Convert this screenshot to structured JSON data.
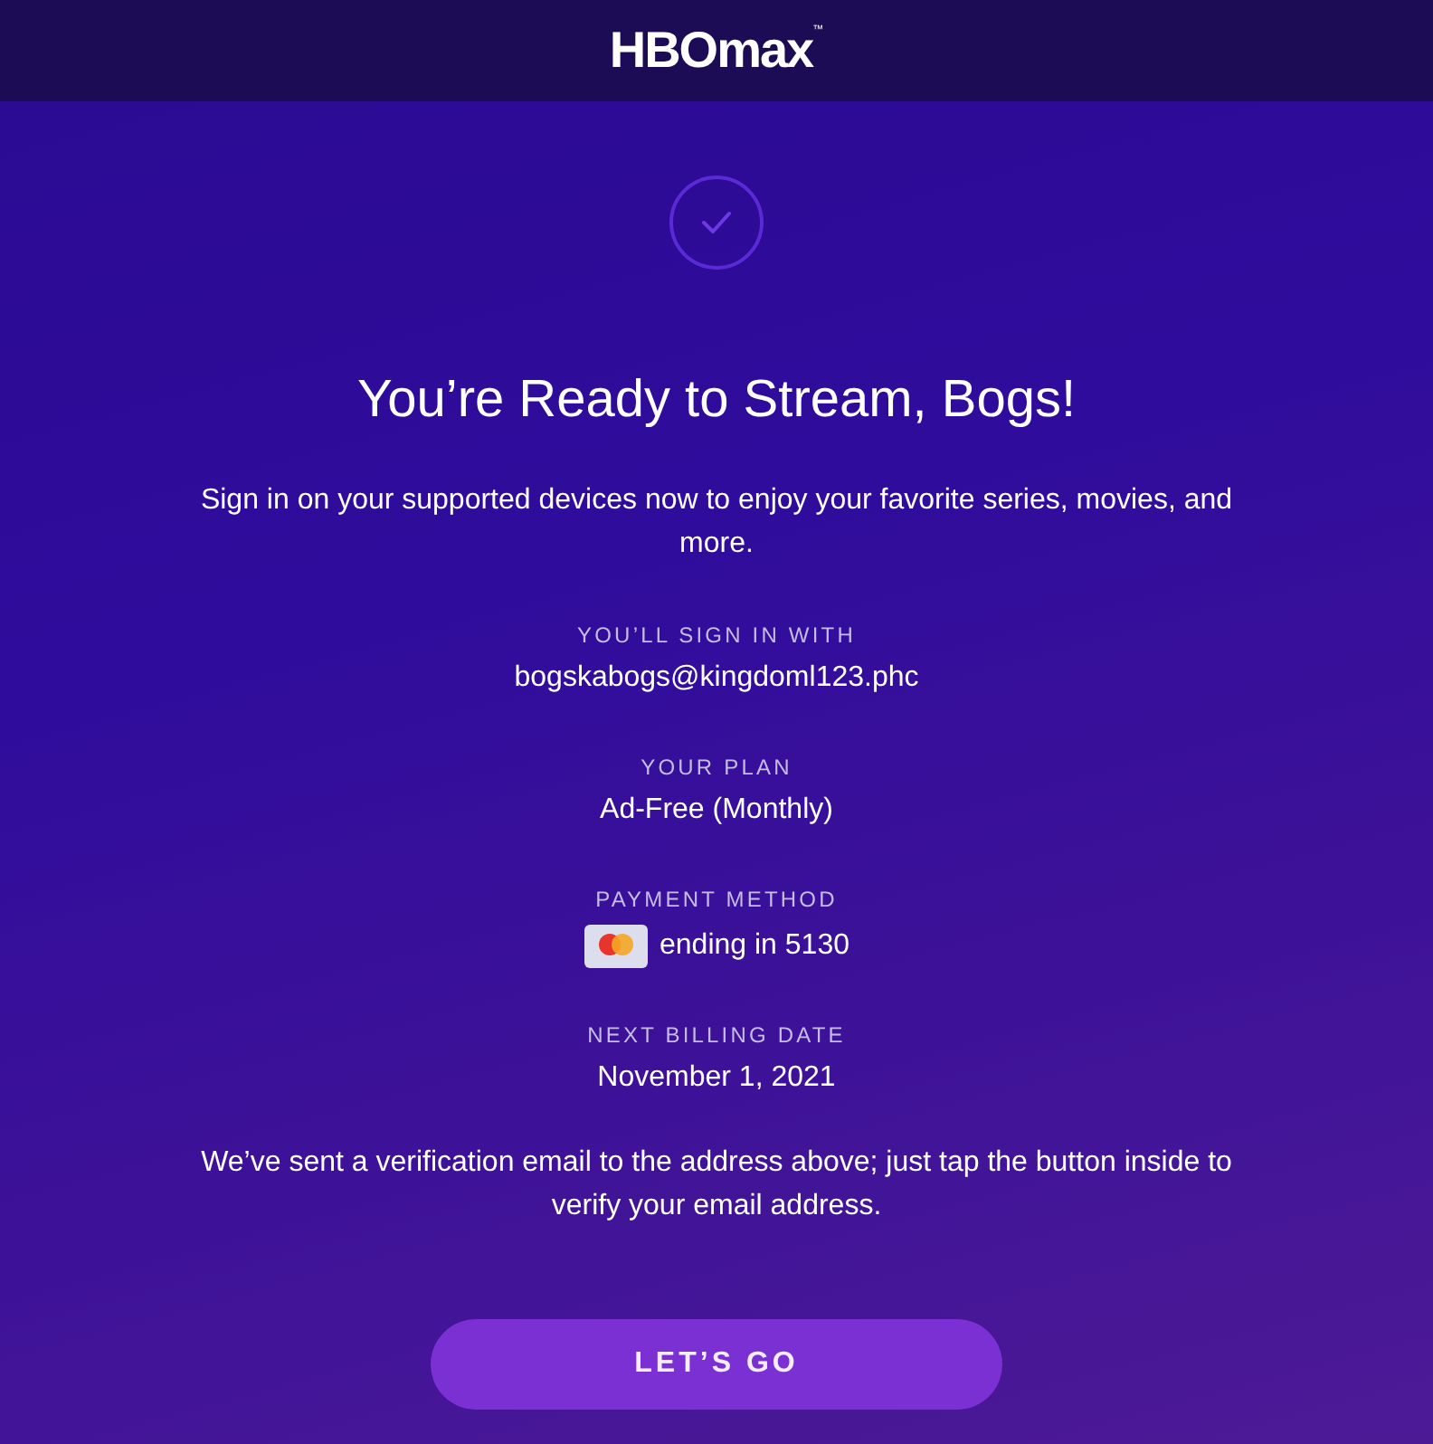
{
  "header": {
    "logo": "HBOmax$^{™}$"
  },
  "title": "You’re Ready to Stream, Bogs!",
  "intro": "Sign in on your supported devices now to enjoy your favorite series, movies, and more.",
  "details": [
    {
      "kind": "text",
      "label": "YOU’LL SIGN IN WITH",
      "value": "bogskabogs@kingdoml123.phc"
    },
    {
      "kind": "text",
      "label": "YOUR PLAN",
      "value": "Ad-Free (Monthly)"
    },
    {
      "kind": "card",
      "label": "PAYMENT METHOD",
      "value": "ending in 5130"
    },
    {
      "kind": "text",
      "label": "NEXT BILLING DATE",
      "value": "November 1, 2021"
    }
  ],
  "note": "We’ve sent a verification email to the address above; just tap the button inside to verify your email address.",
  "button": "LET’S GO"
}
